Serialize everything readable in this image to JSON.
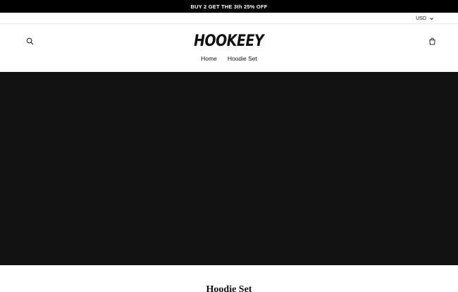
{
  "announcement": {
    "text": "BUY 2 GET THE 3th 25% OFF"
  },
  "currency": {
    "selected": "USD",
    "icon": "chevron-down-icon"
  },
  "header": {
    "logo_text": "HOOKEEY",
    "search_icon": "search-icon",
    "cart_icon": "cart-icon"
  },
  "nav": {
    "items": [
      {
        "label": "Home"
      },
      {
        "label": "Hoodie Set"
      }
    ]
  },
  "hero": {
    "background_color": "#111111"
  },
  "collection": {
    "title": "Hoodie Set"
  },
  "colors": {
    "announcement_bg": "#000000",
    "text": "#111111",
    "page_bg": "#ffffff"
  }
}
